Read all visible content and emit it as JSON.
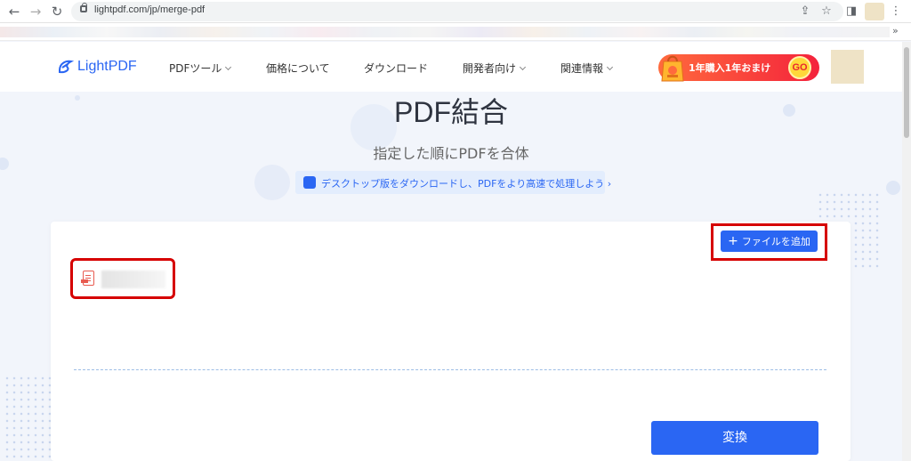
{
  "browser": {
    "url": "lightpdf.com/jp/merge-pdf",
    "more_bookmarks": "»"
  },
  "header": {
    "logo_text": "LightPDF",
    "nav": [
      {
        "label": "PDFツール",
        "has_caret": true
      },
      {
        "label": "価格について",
        "has_caret": false
      },
      {
        "label": "ダウンロード",
        "has_caret": false
      },
      {
        "label": "開発者向け",
        "has_caret": true
      },
      {
        "label": "関連情報",
        "has_caret": true
      }
    ],
    "promo": {
      "text": "1年購入1年おまけ",
      "go": "GO"
    }
  },
  "hero": {
    "title": "PDF結合",
    "subtitle": "指定した順にPDFを合体",
    "download_banner": "デスクトップ版をダウンロードし、PDFをより高速で処理しよう ›"
  },
  "card": {
    "add_file_label": "ファイルを追加",
    "add_file_plus": "+",
    "convert_label": "変換"
  },
  "colors": {
    "accent": "#2a66f3",
    "highlight": "#d60000",
    "promo_start": "#ff6a3d",
    "promo_end": "#f4233c"
  }
}
